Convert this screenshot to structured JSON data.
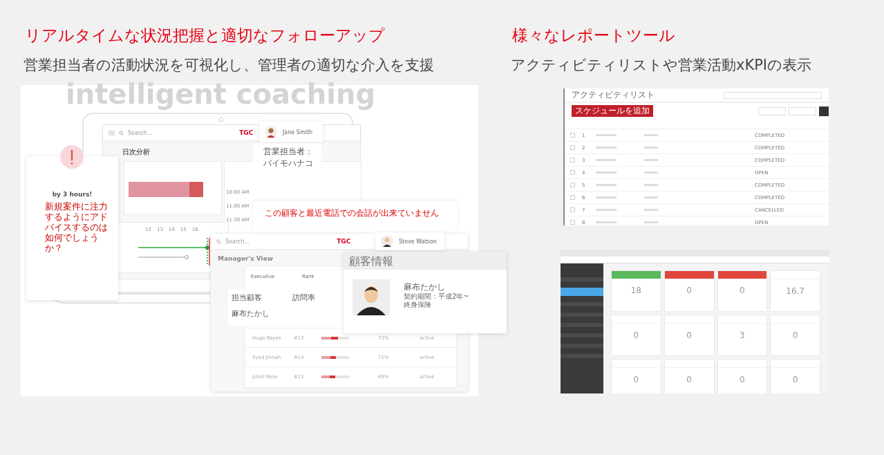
{
  "left": {
    "heading": "リアルタイムな状況把握と適切なフォローアップ",
    "subheading": "営業担当者の活動状況を可視化し、管理者の適切な介入を支援",
    "mockup": {
      "watermark": "intelligent coaching",
      "app_window": {
        "search_placeholder": "Search...",
        "logo": "TGC",
        "page_title": "日次分析",
        "chart_days": [
          "12",
          "13",
          "14",
          "15",
          "16"
        ],
        "times": [
          "10:00 AM",
          "11:00 AM",
          "11:30 AM"
        ]
      },
      "alert": {
        "note": "by 3 hours!",
        "advice": "新規案件に注力するようにアドバイスするのは如何でしょうか？"
      },
      "rep_chip": {
        "name": "Jane Smith"
      },
      "rep_label": [
        "営業担当者：",
        "バイモハナコ"
      ],
      "warning": "この顧客と最近電話での会話が出来ていません",
      "manager_window": {
        "search_placeholder": "Search...",
        "logo": "TGC",
        "user": "Steve Watson",
        "title": "Manager's View",
        "columns": [
          "Executive",
          "Rank"
        ],
        "rows": [
          {
            "name": "Hugo Reyes",
            "rank": "#13",
            "level": 0.6,
            "rate": "73%",
            "status": "active"
          },
          {
            "name": "Syed Jinnah",
            "rank": "#14",
            "level": 0.53,
            "rate": "71%",
            "status": "active"
          },
          {
            "name": "Juliet Rose",
            "rank": "#15",
            "level": 0.5,
            "rate": "69%",
            "status": "active"
          }
        ]
      },
      "assigned": {
        "columns": [
          "担当顧客",
          "訪問率"
        ],
        "customer": "麻布たかし"
      },
      "customer_card": {
        "title": "顧客情報",
        "name": "麻布たかし",
        "contract": "契約期間：平成2年~",
        "product": "終身保険"
      }
    }
  },
  "right": {
    "heading": "様々なレポートツール",
    "subheading": "アクティビティリストや営業活動xKPIの表示",
    "activity_list": {
      "title": "アクティビティリスト",
      "add_button": "スケジュールを追加",
      "rows": [
        {
          "number": "1",
          "status": "COMPLETED",
          "checked": false
        },
        {
          "number": "2",
          "status": "COMPLETED",
          "checked": false
        },
        {
          "number": "3",
          "status": "COMPLETED",
          "checked": false
        },
        {
          "number": "4",
          "status": "OPEN",
          "checked": false
        },
        {
          "number": "5",
          "status": "COMPLETED",
          "checked": false
        },
        {
          "number": "6",
          "status": "COMPLETED",
          "checked": false
        },
        {
          "number": "7",
          "status": "CANCELLED",
          "checked": false
        },
        {
          "number": "8",
          "status": "OPEN",
          "checked": false
        }
      ]
    },
    "dashboard": {
      "sidebar": [
        {
          "selected": false
        },
        {
          "selected": true
        },
        {
          "selected": false
        },
        {
          "selected": false
        },
        {
          "selected": false
        },
        {
          "selected": false
        },
        {
          "selected": false
        },
        {
          "selected": false
        }
      ],
      "cards": [
        {
          "value": "18",
          "color": "#5cb85c"
        },
        {
          "value": "0",
          "color": "#e0463c"
        },
        {
          "value": "0",
          "color": "#e0463c"
        },
        {
          "value": "16.7"
        },
        {
          "value": "0"
        },
        {
          "value": "0"
        },
        {
          "value": "3"
        },
        {
          "value": "0"
        },
        {
          "value": "0"
        },
        {
          "value": "0"
        },
        {
          "value": "0"
        },
        {
          "value": "0"
        }
      ]
    }
  }
}
